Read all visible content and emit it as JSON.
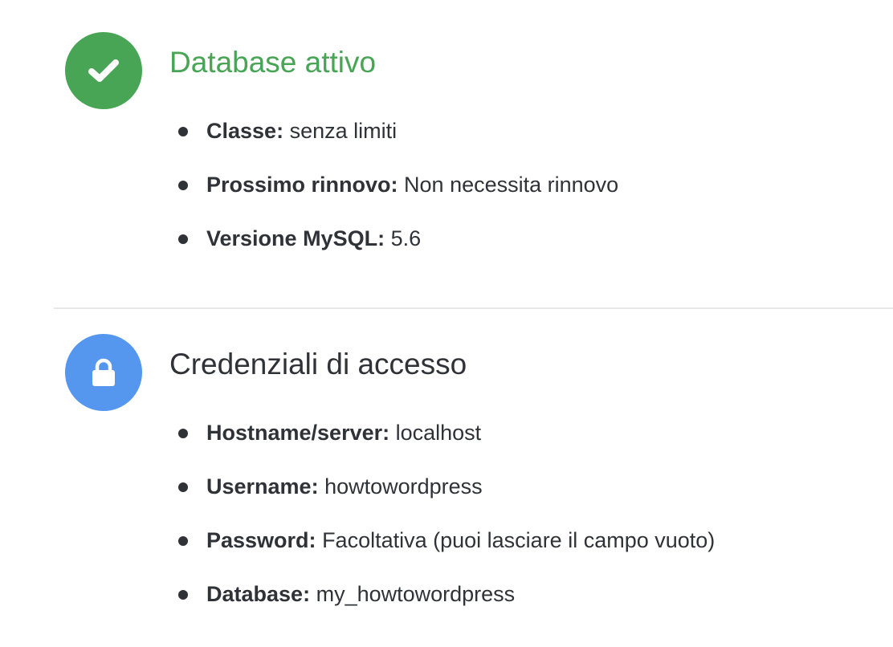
{
  "colors": {
    "success": "#48a555",
    "info": "#5596ef",
    "text": "#2f3237",
    "divider": "#e7e8ea"
  },
  "status": {
    "icon": "check-icon",
    "title": "Database attivo",
    "items": [
      {
        "key": "Classe:",
        "value": "senza limiti"
      },
      {
        "key": "Prossimo rinnovo:",
        "value": "Non necessita rinnovo"
      },
      {
        "key": "Versione MySQL:",
        "value": "5.6"
      }
    ]
  },
  "credentials": {
    "icon": "lock-icon",
    "title": "Credenziali di accesso",
    "items": [
      {
        "key": "Hostname/server:",
        "value": "localhost"
      },
      {
        "key": "Username:",
        "value": "howtowordpress"
      },
      {
        "key": "Password:",
        "value": "Facoltativa (puoi lasciare il campo vuoto)"
      },
      {
        "key": "Database:",
        "value": "my_howtowordpress"
      }
    ]
  }
}
